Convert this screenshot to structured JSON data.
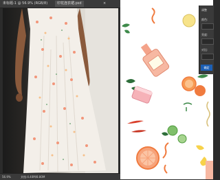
{
  "tabs": [
    {
      "label": "未标题-1 @ 56.9% (RGB/8)",
      "active": false
    },
    {
      "label": "印花连衣裙.psd",
      "active": true
    }
  ],
  "status": {
    "zoom": "56.9%",
    "doc_info": "文档:4.40M/8.80M"
  },
  "panel": {
    "title": "调整",
    "fields": [
      "颜色:",
      "亮度:",
      "对比:"
    ],
    "ok_label": "确定"
  },
  "colors": {
    "ui_dark": "#3a3a3a",
    "accent": "#1c5fb4",
    "peach": "#f4a38a",
    "orange": "#f07b3f",
    "leaf": "#3e8a4a"
  }
}
